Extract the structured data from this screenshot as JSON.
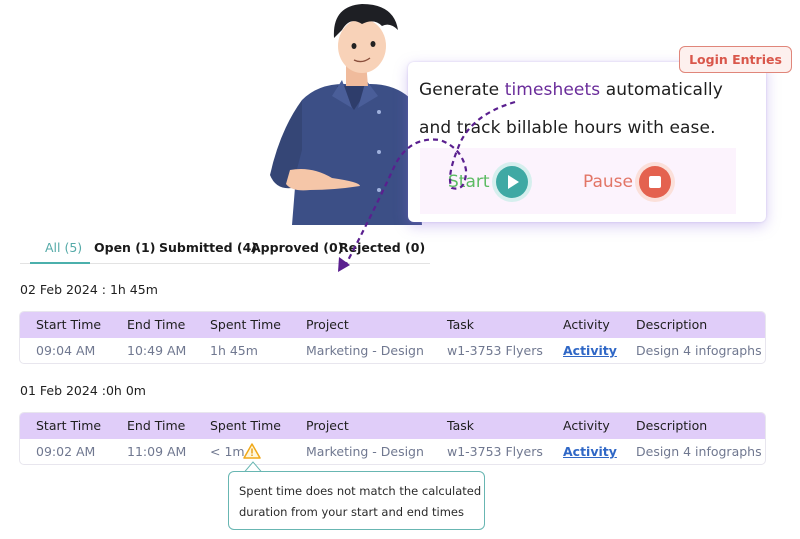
{
  "promo": {
    "line1_before": "Generate ",
    "line1_accent": "timesheets",
    "line1_after": " automatically",
    "line2": "and track billable hours with ease.",
    "start_label": "Start",
    "pause_label": "Pause",
    "badge": "Login Entries",
    "colors": {
      "accent": "#6a2c9a",
      "start": "#5cbb63",
      "pause": "#e27566"
    }
  },
  "tabs": [
    {
      "label": "All (5)",
      "active": true
    },
    {
      "label": "Open (1)",
      "active": false
    },
    {
      "label": "Submitted (4)",
      "active": false
    },
    {
      "label": "Approved (0)",
      "active": false
    },
    {
      "label": "Rejected (0)",
      "active": false
    }
  ],
  "columns": [
    "Start Time",
    "End Time",
    "Spent Time",
    "Project",
    "Task",
    "Activity",
    "Description"
  ],
  "days": [
    {
      "header": "02 Feb 2024 : 1h 45m",
      "rows": [
        {
          "start": "09:04 AM",
          "end": "10:49 AM",
          "spent": "1h 45m",
          "project": "Marketing - Design",
          "task": "w1-3753 Flyers",
          "activity": "Activity",
          "description": "Design 4 infographs"
        }
      ]
    },
    {
      "header": "01 Feb 2024 :0h 0m",
      "rows": [
        {
          "start": "09:02 AM",
          "end": "11:09 AM",
          "spent": "< 1m",
          "spent_warning": true,
          "project": "Marketing - Design",
          "task": "w1-3753 Flyers",
          "activity": "Activity",
          "description": "Design 4 infographs"
        }
      ]
    }
  ],
  "tooltip": {
    "line1": "Spent time does not match the calculated",
    "line2": "duration from your start and end times"
  },
  "icons": {
    "play": "play-icon",
    "stop": "stop-icon",
    "warning": "warning-icon"
  }
}
